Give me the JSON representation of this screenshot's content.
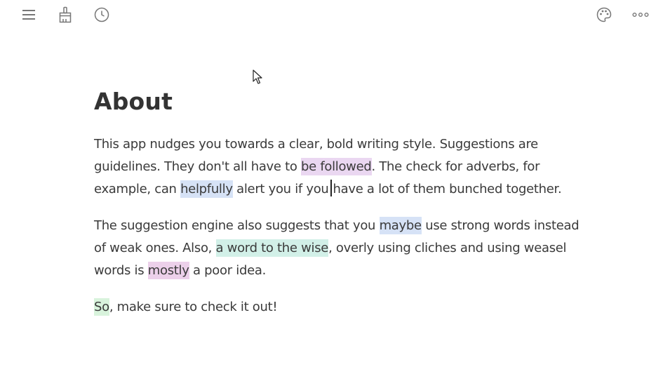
{
  "toolbar": {
    "left_icons": [
      "hamburger-menu-icon",
      "brush-icon",
      "clock-icon"
    ],
    "right_icons": [
      "palette-icon",
      "more-dots-icon"
    ]
  },
  "document": {
    "title": "About",
    "paragraphs": [
      {
        "segments": [
          {
            "text": "This app nudges you towards a clear, bold writing style. Suggestions are guidelines. They don't all have to ",
            "highlight": null
          },
          {
            "text": "be followed",
            "highlight": "purple"
          },
          {
            "text": ". The check for adverbs, for example, can ",
            "highlight": null
          },
          {
            "text": "helpfully",
            "highlight": "blue"
          },
          {
            "text": " alert you if you",
            "highlight": null
          },
          {
            "text": "have a lot of them bunched together.",
            "highlight": null
          }
        ]
      },
      {
        "segments": [
          {
            "text": "The suggestion engine also suggests that you ",
            "highlight": null
          },
          {
            "text": "maybe",
            "highlight": "blue"
          },
          {
            "text": " use strong words instead of weak ones. Also, ",
            "highlight": null
          },
          {
            "text": "a word to the wise",
            "highlight": "teal"
          },
          {
            "text": ", overly using cliches and using weasel words is ",
            "highlight": null
          },
          {
            "text": "mostly",
            "highlight": "pink"
          },
          {
            "text": " a poor idea.",
            "highlight": null
          }
        ]
      },
      {
        "segments": [
          {
            "text": "So",
            "highlight": "green"
          },
          {
            "text": ", make sure to check it out!",
            "highlight": null
          }
        ]
      }
    ]
  },
  "colors": {
    "highlight_purple": "#ead7f1",
    "highlight_blue": "#d6e2f6",
    "highlight_teal": "#d2f0e8",
    "highlight_pink": "#ecd0ea",
    "highlight_green": "#d8f3dc",
    "icon_gray": "#777777",
    "text": "#3a3a3a"
  }
}
